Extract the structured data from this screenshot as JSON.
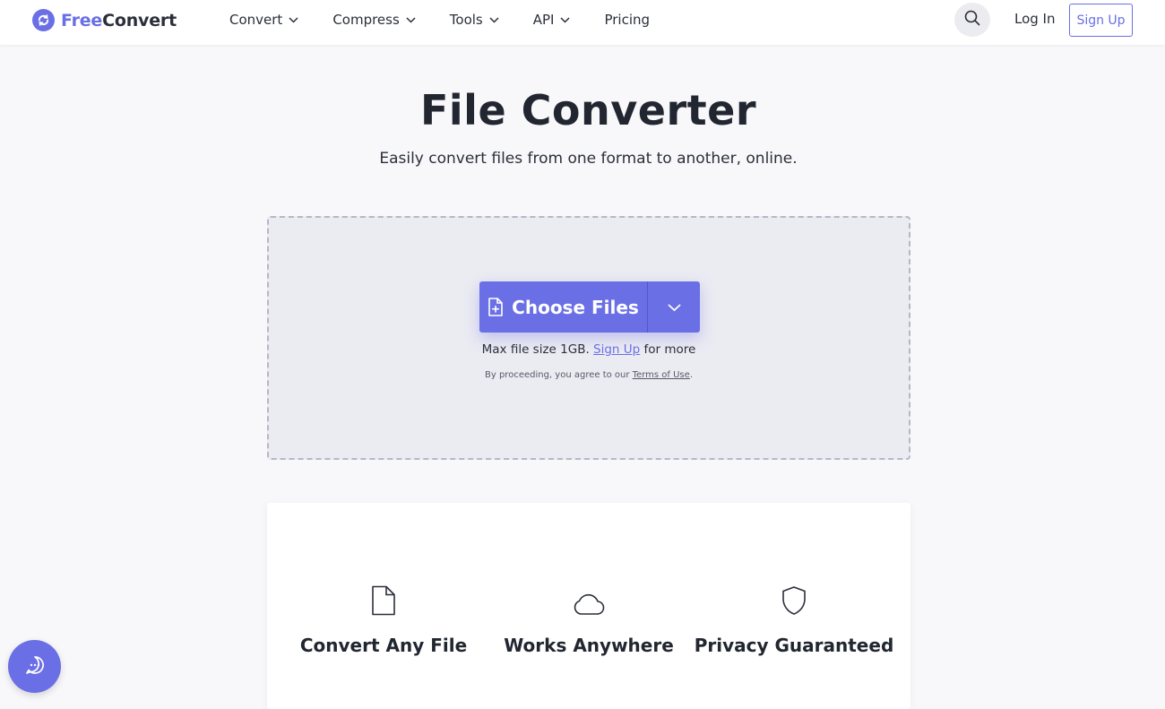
{
  "header": {
    "logo": {
      "part1": "Free",
      "part2": "Convert"
    },
    "nav": [
      {
        "label": "Convert"
      },
      {
        "label": "Compress"
      },
      {
        "label": "Tools"
      },
      {
        "label": "API"
      },
      {
        "label": "Pricing"
      }
    ],
    "login_label": "Log In",
    "signup_label": "Sign Up"
  },
  "hero": {
    "title": "File Converter",
    "subtitle": "Easily convert files from one format to another, online."
  },
  "upload": {
    "choose_label": "Choose Files",
    "max_prefix": "Max file size 1GB.",
    "max_link": "Sign Up",
    "max_suffix": "for more",
    "terms_prefix": "By proceeding, you agree to our",
    "terms_link": "Terms of Use",
    "terms_suffix": "."
  },
  "features": [
    {
      "title": "Convert Any File",
      "icon": "file-icon"
    },
    {
      "title": "Works Anywhere",
      "icon": "cloud-icon"
    },
    {
      "title": "Privacy Guaranteed",
      "icon": "shield-icon"
    }
  ],
  "colors": {
    "accent": "#6a6fe5",
    "text": "#212630",
    "dropzone_bg": "#ebebf2"
  }
}
